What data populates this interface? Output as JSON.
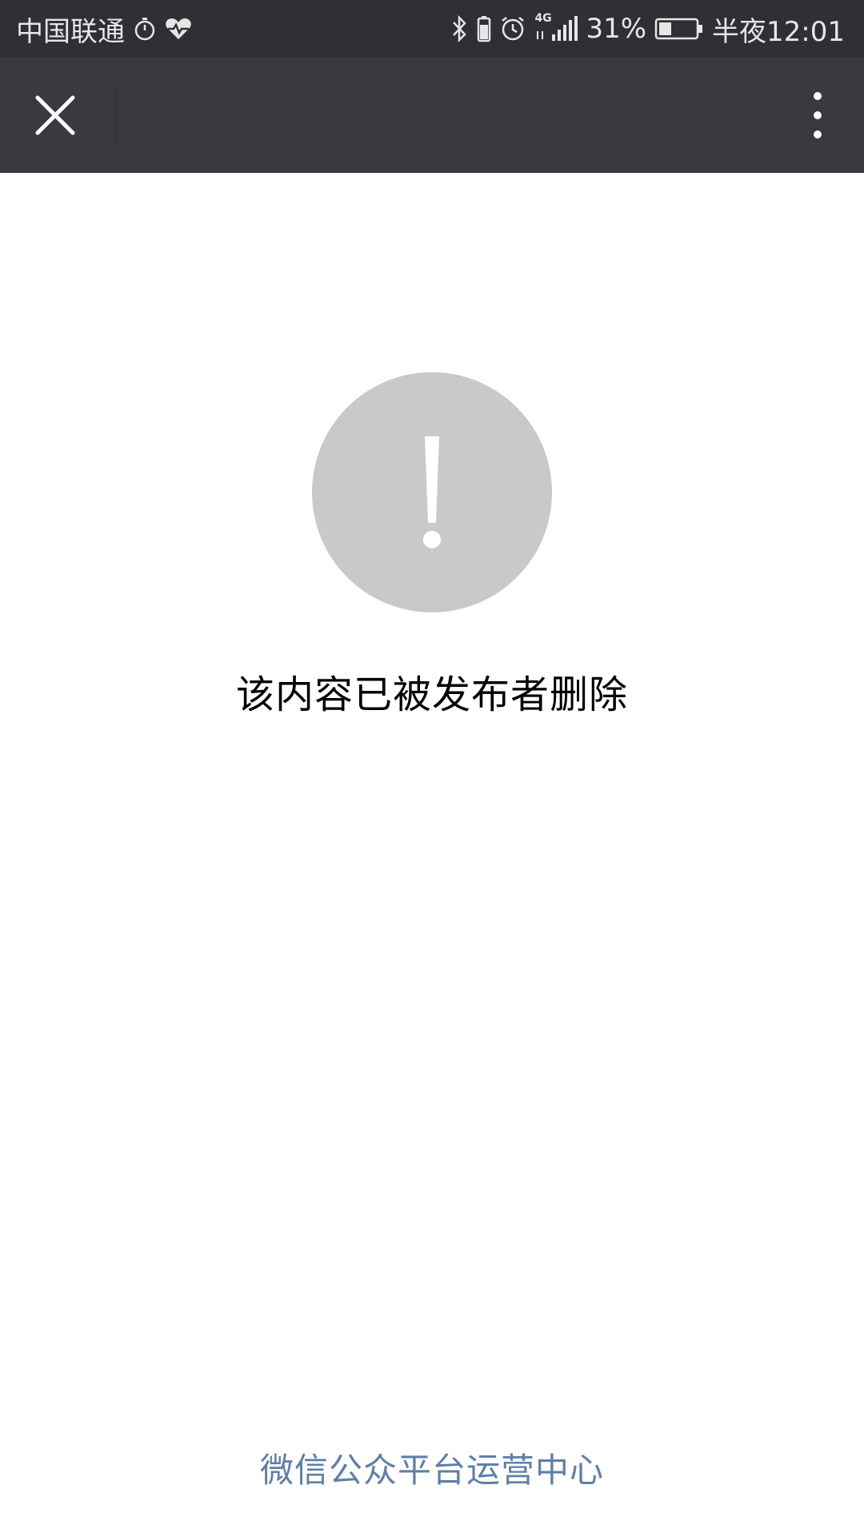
{
  "status_bar": {
    "carrier": "中国联通",
    "network": "4G",
    "battery": "31%",
    "time": "半夜12:01"
  },
  "nav": {
    "close_icon": "close-icon",
    "more_icon": "more-vertical-icon"
  },
  "main": {
    "icon": "exclamation-icon",
    "message": "该内容已被发布者删除"
  },
  "footer": {
    "link_text": "微信公众平台运营中心"
  },
  "colors": {
    "status_bar_bg": "#2f3034",
    "nav_bg": "#393a3f",
    "icon_circle": "#c9c9c9",
    "link": "#5f7fa8"
  }
}
